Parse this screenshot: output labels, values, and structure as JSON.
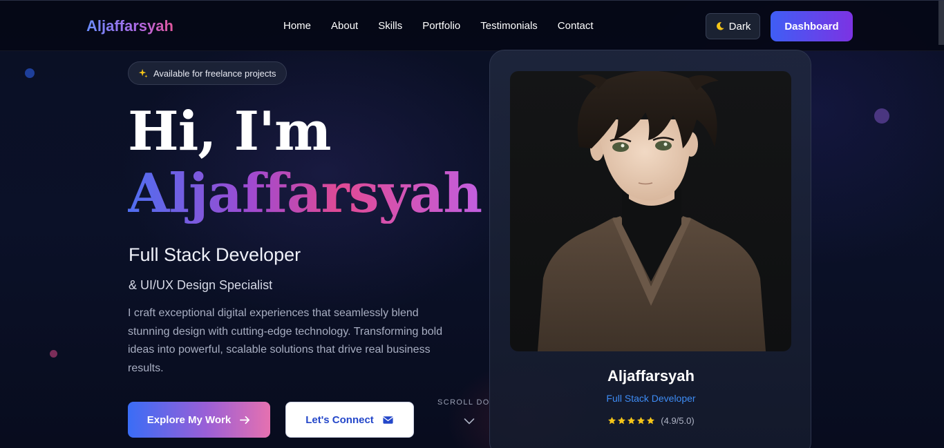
{
  "navbar": {
    "brand": "Aljaffarsyah",
    "links": [
      "Home",
      "About",
      "Skills",
      "Portfolio",
      "Testimonials",
      "Contact"
    ],
    "theme_toggle_label": "Dark",
    "theme_icon": "moon-icon",
    "dashboard_label": "Dashboard"
  },
  "hero": {
    "badge_icon": "sparkle-icon",
    "badge_text": "Available for freelance projects",
    "greeting": "Hi, I'm",
    "name": "Aljaffarsyah",
    "title": "Full Stack Developer",
    "subtitle": "& UI/UX Design Specialist",
    "description": "I craft exceptional digital experiences that seamlessly blend stunning design with cutting-edge technology. Transforming bold ideas into powerful, scalable solutions that drive real business results.",
    "primary_button": "Explore My Work",
    "primary_icon": "arrow-right-icon",
    "secondary_button": "Let's Connect",
    "secondary_icon": "mail-icon",
    "scroll_label": "SCROLL DOWN",
    "scroll_icon": "chevron-down-icon"
  },
  "profile_card": {
    "name": "Aljaffarsyah",
    "role": "Full Stack Developer",
    "stars": 5,
    "rating_text": "(4.9/5.0)",
    "star_color": "#f5c518"
  },
  "colors": {
    "accent_blue": "#3e8cf5",
    "accent_purple": "#7c33e3",
    "accent_pink": "#e04a94",
    "background": "#0a0f24"
  }
}
